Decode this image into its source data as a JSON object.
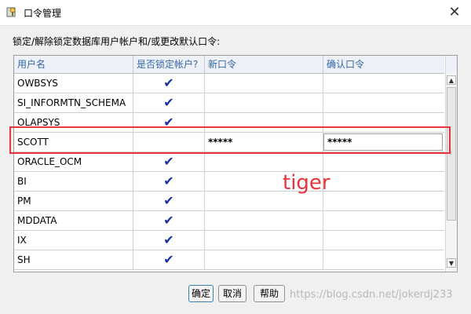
{
  "window": {
    "title": "口令管理",
    "close_symbol": "✕"
  },
  "instruction": "锁定/解除锁定数据库用户帐户和/或更改默认口令:",
  "table": {
    "headers": [
      "用户名",
      "是否锁定帐户?",
      "新口令",
      "确认口令"
    ],
    "rows": [
      {
        "user": "OWBSYS",
        "locked": "✔",
        "new_password": "",
        "confirm_password": ""
      },
      {
        "user": "SI_INFORMTN_SCHEMA",
        "locked": "✔",
        "new_password": "",
        "confirm_password": ""
      },
      {
        "user": "OLAPSYS",
        "locked": "✔",
        "new_password": "",
        "confirm_password": ""
      },
      {
        "user": "SCOTT",
        "locked": "",
        "new_password": "*****",
        "confirm_password": "*****"
      },
      {
        "user": "ORACLE_OCM",
        "locked": "✔",
        "new_password": "",
        "confirm_password": ""
      },
      {
        "user": "BI",
        "locked": "✔",
        "new_password": "",
        "confirm_password": ""
      },
      {
        "user": "PM",
        "locked": "✔",
        "new_password": "",
        "confirm_password": ""
      },
      {
        "user": "MDDATA",
        "locked": "✔",
        "new_password": "",
        "confirm_password": ""
      },
      {
        "user": "IX",
        "locked": "✔",
        "new_password": "",
        "confirm_password": ""
      },
      {
        "user": "SH",
        "locked": "✔",
        "new_password": "",
        "confirm_password": ""
      }
    ]
  },
  "scrollbar": {
    "up": "▲",
    "down": "▼",
    "grip": "⁞"
  },
  "annotation": "tiger",
  "buttons": {
    "ok": "确定",
    "cancel": "取消",
    "help": "帮助"
  },
  "watermark": "https://blog.csdn.net/jokerdj233",
  "colors": {
    "highlight": "#e8343a",
    "header_text": "#3366aa",
    "checkmark": "#1a2fa0"
  }
}
